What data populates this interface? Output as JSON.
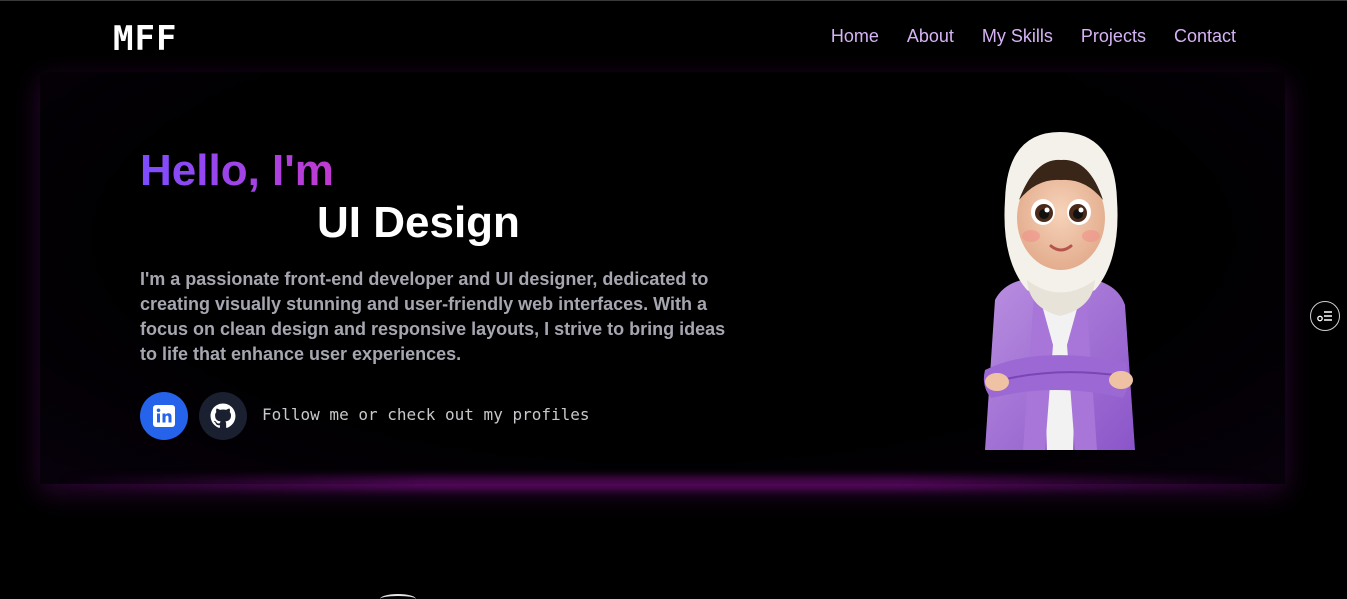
{
  "nav": {
    "logo": "MFF",
    "links": [
      "Home",
      "About",
      "My Skills",
      "Projects",
      "Contact"
    ]
  },
  "hero": {
    "greeting": "Hello, I'm",
    "role": "UI Design",
    "bio": "I'm a passionate front-end developer and UI designer, dedicated to creating visually stunning and user-friendly web interfaces. With a focus on clean design and responsive layouts, I strive to bring ideas to life that enhance user experiences.",
    "follow_text": "Follow me or check out my profiles"
  },
  "social": {
    "linkedin_icon": "linkedin-icon",
    "github_icon": "github-icon"
  },
  "colors": {
    "background": "#000000",
    "nav_link": "#d6b3f5",
    "gradient_start": "#7c4dff",
    "gradient_end": "#c23ad0",
    "linkedin_bg": "#2563eb",
    "github_bg": "#1a2030",
    "bio_text": "#a6a6b0"
  }
}
